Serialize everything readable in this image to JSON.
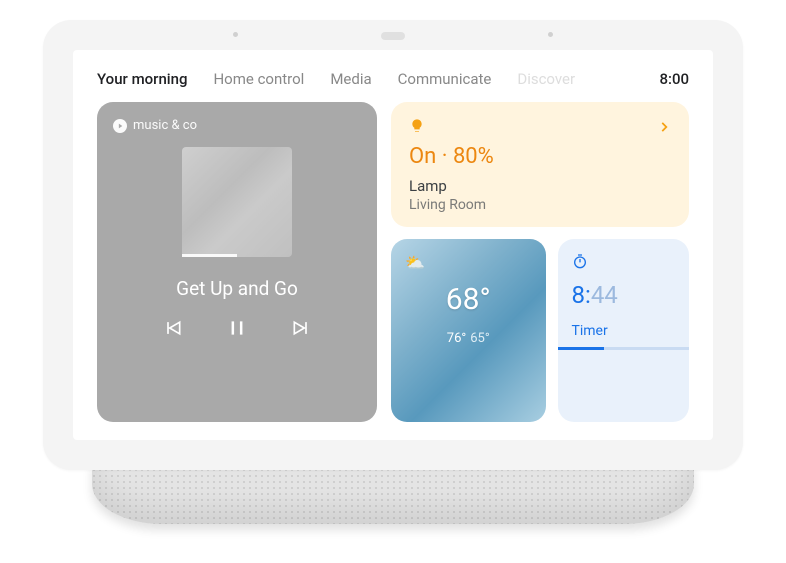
{
  "tabs": {
    "items": [
      "Your morning",
      "Home control",
      "Media",
      "Communicate",
      "Discover"
    ],
    "active_index": 0
  },
  "clock": "8:00",
  "music": {
    "source": "music & co",
    "track": "Get Up and Go"
  },
  "lamp": {
    "state": "On · 80%",
    "name": "Lamp",
    "room": "Living Room"
  },
  "weather": {
    "temp": "68°",
    "high": "76°",
    "low": "65°"
  },
  "timer": {
    "minutes": "8:",
    "seconds": "44",
    "label": "Timer"
  }
}
